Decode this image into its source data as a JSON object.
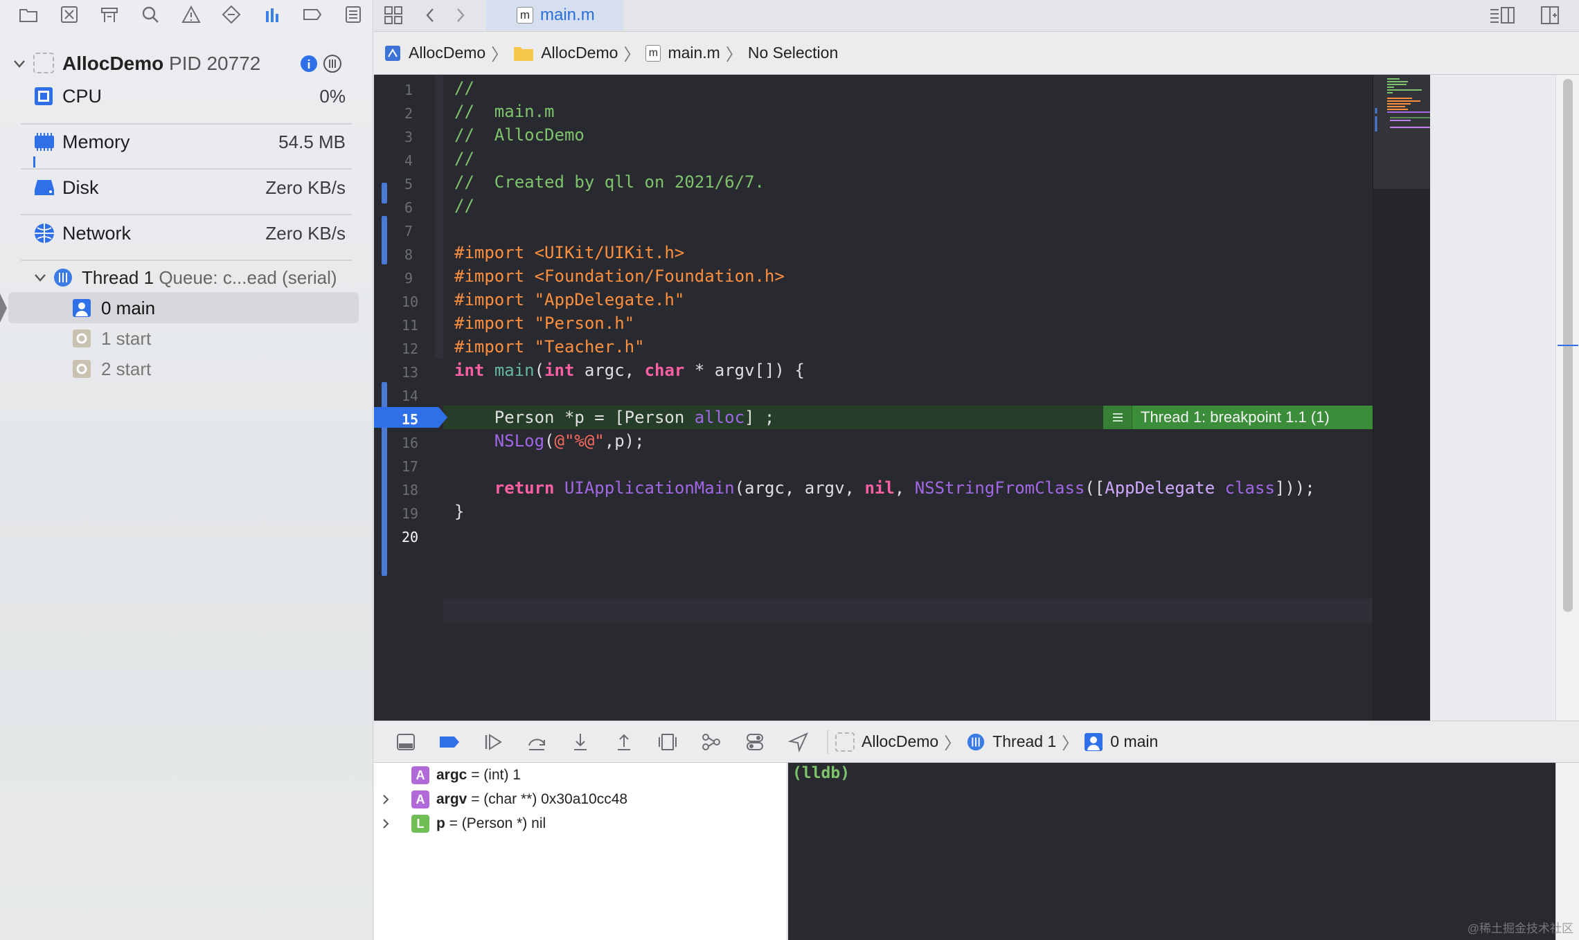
{
  "navigator": {
    "process": {
      "name": "AllocDemo",
      "pid": "PID 20772"
    },
    "gauges": [
      {
        "label": "CPU",
        "value": "0%"
      },
      {
        "label": "Memory",
        "value": "54.5 MB"
      },
      {
        "label": "Disk",
        "value": "Zero KB/s"
      },
      {
        "label": "Network",
        "value": "Zero KB/s"
      }
    ],
    "thread": {
      "name": "Thread 1",
      "queue": "Queue: c...ead (serial)"
    },
    "frames": [
      "0 main",
      "1 start",
      "2 start"
    ]
  },
  "tab": {
    "label": "main.m",
    "icon_letter": "m"
  },
  "jumpbar": [
    "AllocDemo",
    "AllocDemo",
    "main.m",
    "No Selection"
  ],
  "editor": {
    "line_numbers": [
      "1",
      "2",
      "3",
      "4",
      "5",
      "6",
      "7",
      "8",
      "9",
      "10",
      "11",
      "12",
      "13",
      "14",
      "15",
      "16",
      "17",
      "18",
      "19",
      "20"
    ],
    "breakpoint_annotation": "Thread 1: breakpoint 1.1 (1)"
  },
  "debug_bar": {
    "crumbs": [
      "AllocDemo",
      "Thread 1",
      "0 main"
    ]
  },
  "variables": [
    {
      "badge": "A",
      "name": "argc",
      "value": "= (int) 1"
    },
    {
      "badge": "A",
      "name": "argv",
      "value": "= (char **) 0x30a10cc48"
    },
    {
      "badge": "L",
      "name": "p",
      "value": "= (Person *) nil"
    }
  ],
  "console": {
    "prompt": "(lldb)"
  },
  "watermark": "@稀土掘金技术社区",
  "colors": {
    "accent": "#2f6fe8",
    "breakpoint_annot": "#3c8d3a",
    "editor_bg": "#292a30"
  }
}
